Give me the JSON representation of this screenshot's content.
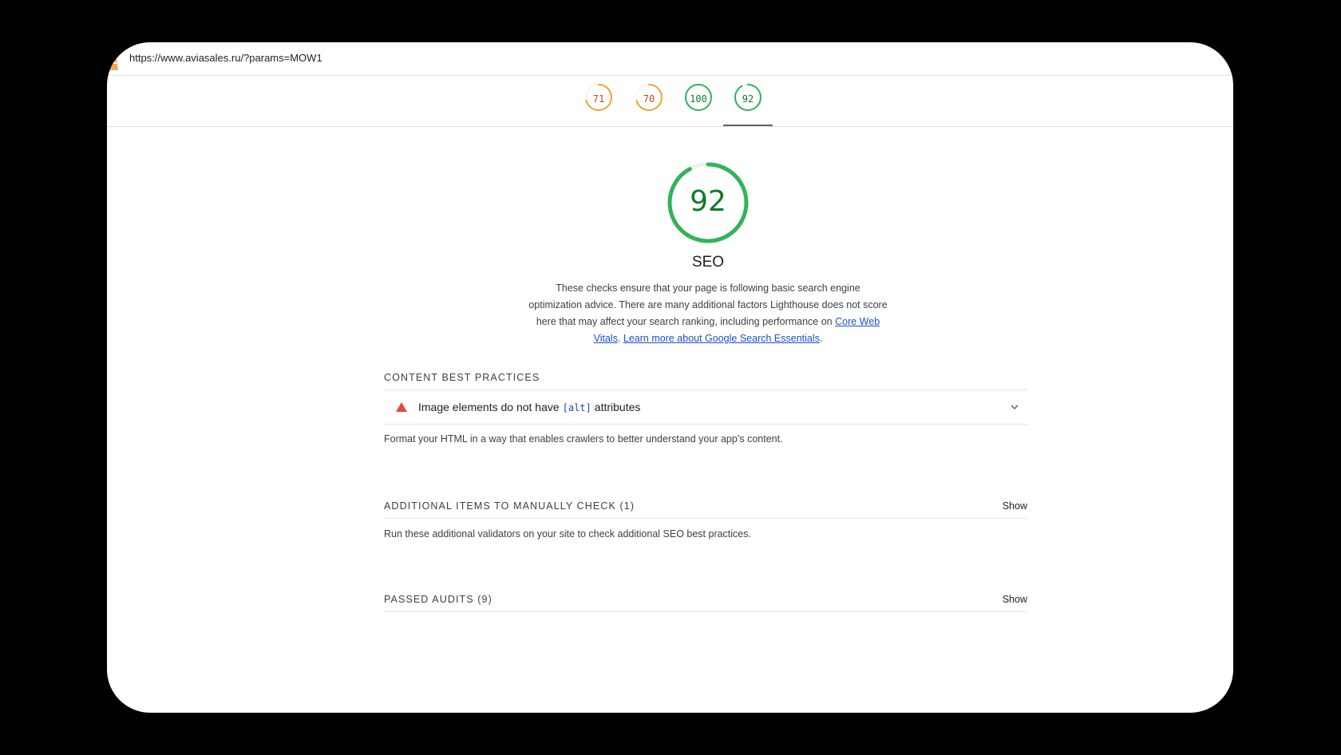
{
  "browser": {
    "url": "https://www.aviasales.ru/?params=MOW1"
  },
  "gauges": [
    {
      "label": "71",
      "value": 71,
      "color": "#f0a33a",
      "text_color": "#b3501b"
    },
    {
      "label": "70",
      "value": 70,
      "color": "#f0a33a",
      "text_color": "#b3501b"
    },
    {
      "label": "100",
      "value": 100,
      "color": "#33b35a",
      "text_color": "#0c7a2a"
    },
    {
      "label": "92",
      "value": 92,
      "color": "#33b35a",
      "text_color": "#0c7a2a"
    }
  ],
  "active_gauge_index": 3,
  "category": {
    "score_label": "92",
    "score_value": 92,
    "gauge_color": "#33b35a",
    "title": "SEO",
    "description": "These checks ensure that your page is following basic search engine optimization advice. There are many additional factors Lighthouse does not score here that may affect your search ranking, including performance on ",
    "link1": "Core Web Vitals",
    "link_sep": ". ",
    "link2": "Learn more about Google Search Essentials",
    "link_end": "."
  },
  "content_best_practices": {
    "header": "CONTENT BEST PRACTICES",
    "audit": {
      "icon": "warning-triangle-icon",
      "title_before": "Image elements do not have",
      "title_code": "[alt]",
      "title_after": "attributes"
    },
    "description": "Format your HTML in a way that enables crawlers to better understand your app’s content."
  },
  "manual_checks": {
    "header": "ADDITIONAL ITEMS TO MANUALLY CHECK (1)",
    "show_label": "Show",
    "description": "Run these additional validators on your site to check additional SEO best practices."
  },
  "passed_audits": {
    "header": "PASSED AUDITS (9)",
    "show_label": "Show"
  }
}
